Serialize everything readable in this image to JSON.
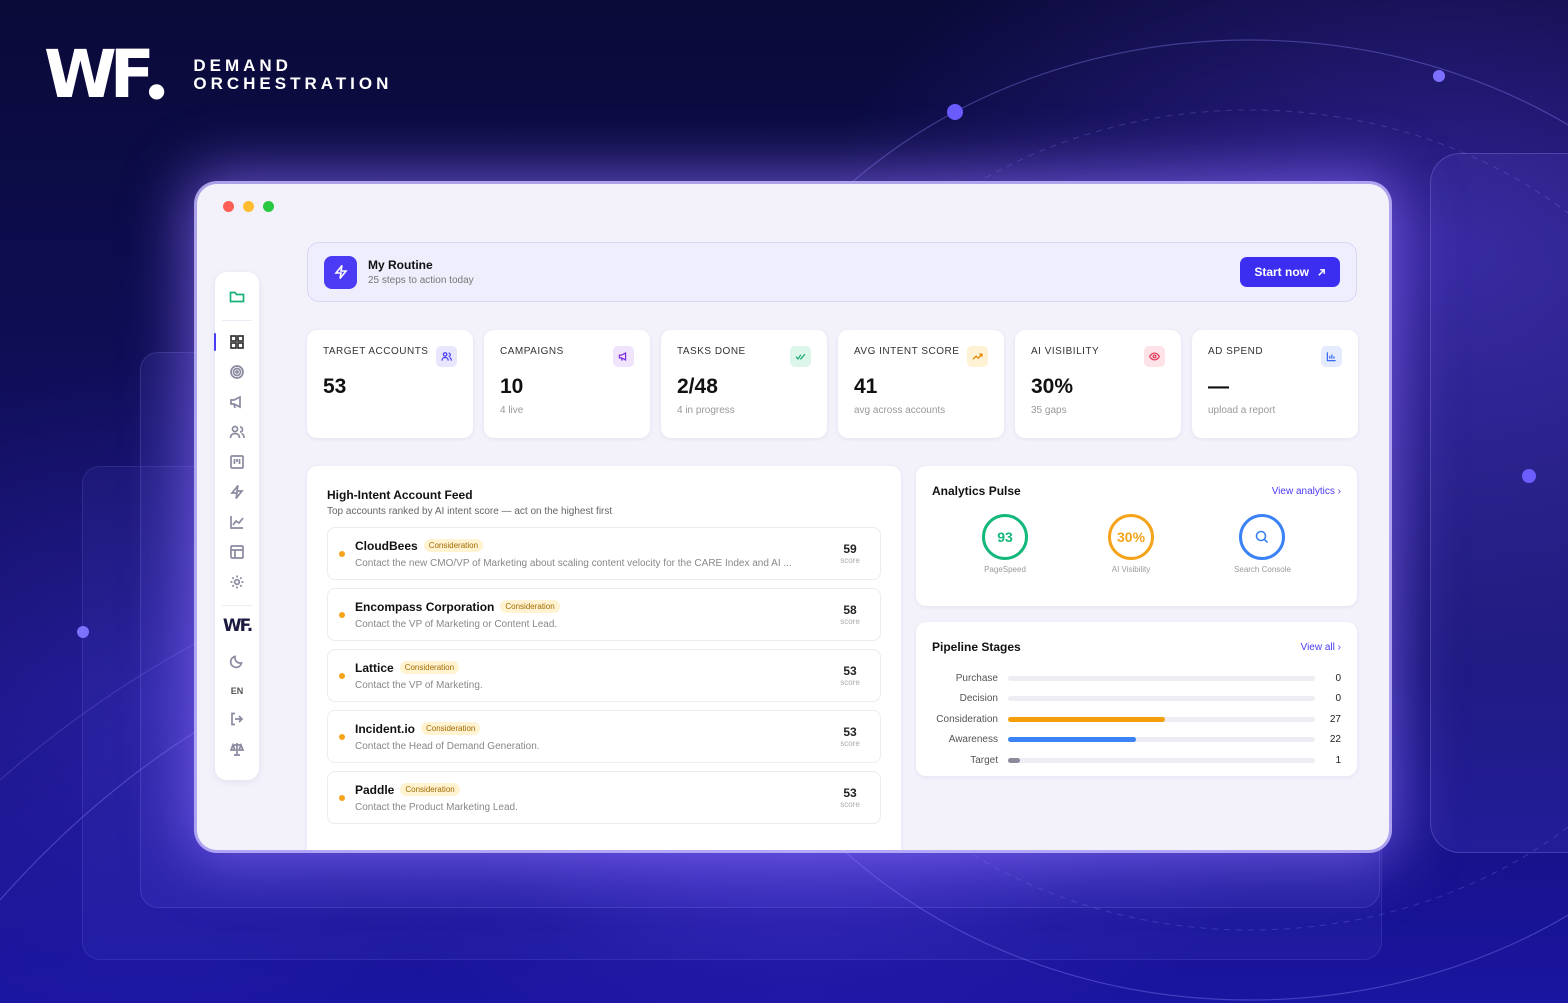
{
  "brand": {
    "line1": "DEMAND",
    "line2": "ORCHESTRATION"
  },
  "colors": {
    "accent": "#3b2ef0",
    "score_dot": "#f5a31a"
  },
  "sidebar": {
    "lang": "EN",
    "icons": [
      "folder-icon",
      "dashboard-icon",
      "target-icon",
      "megaphone-icon",
      "users-icon",
      "board-icon",
      "bolt-icon",
      "chart-line-icon",
      "layout-icon",
      "gear-icon",
      "wf-logo",
      "moon-icon",
      "logout-icon",
      "scale-icon"
    ]
  },
  "routine": {
    "title": "My Routine",
    "subtitle": "25 steps to action today",
    "button": "Start now"
  },
  "stats": [
    {
      "label": "TARGET ACCOUNTS",
      "value": "53",
      "sub": "",
      "icon": "users-icon",
      "color": "#4b3bf5",
      "bg": "#e8e6fd"
    },
    {
      "label": "CAMPAIGNS",
      "value": "10",
      "sub": "4 live",
      "icon": "megaphone-icon",
      "color": "#7b2ee0",
      "bg": "#efe4fb"
    },
    {
      "label": "TASKS DONE",
      "value": "2/48",
      "sub": "4 in progress",
      "icon": "check-icon",
      "color": "#15a86a",
      "bg": "#ddf6ea"
    },
    {
      "label": "AVG INTENT SCORE",
      "value": "41",
      "sub": "avg across accounts",
      "icon": "trend-icon",
      "color": "#e08a00",
      "bg": "#fff1d4"
    },
    {
      "label": "AI VISIBILITY",
      "value": "30%",
      "sub": "35 gaps",
      "icon": "eye-icon",
      "color": "#e23a5a",
      "bg": "#fde3e8"
    },
    {
      "label": "AD SPEND",
      "value": "—",
      "sub": "upload a report",
      "icon": "bar-chart-icon",
      "color": "#3b6bf0",
      "bg": "#e3ebfd"
    }
  ],
  "feed": {
    "title": "High-Intent Account Feed",
    "subtitle": "Top accounts ranked by AI intent score — act on the highest first",
    "items": [
      {
        "name": "CloudBees",
        "stage": "Consideration",
        "desc": "Contact the new CMO/VP of Marketing about scaling content velocity for the CARE Index and AI ...",
        "score": "59",
        "score_label": "score"
      },
      {
        "name": "Encompass Corporation",
        "stage": "Consideration",
        "desc": "Contact the VP of Marketing or Content Lead.",
        "score": "58",
        "score_label": "score"
      },
      {
        "name": "Lattice",
        "stage": "Consideration",
        "desc": "Contact the VP of Marketing.",
        "score": "53",
        "score_label": "score"
      },
      {
        "name": "Incident.io",
        "stage": "Consideration",
        "desc": "Contact the Head of Demand Generation.",
        "score": "53",
        "score_label": "score"
      },
      {
        "name": "Paddle",
        "stage": "Consideration",
        "desc": "Contact the Product Marketing Lead.",
        "score": "53",
        "score_label": "score"
      }
    ]
  },
  "pulse": {
    "title": "Analytics Pulse",
    "link": "View analytics",
    "gauges": [
      {
        "value": "93",
        "label": "PageSpeed",
        "color": "#14b87a"
      },
      {
        "value": "30%",
        "label": "AI Visibility",
        "color": "#f5a31a"
      },
      {
        "value": "",
        "label": "Search Console",
        "color": "#3b82f6"
      }
    ]
  },
  "pipeline": {
    "title": "Pipeline Stages",
    "link": "View all",
    "max": 27,
    "rows": [
      {
        "label": "Purchase",
        "value": 0,
        "color": "#cfcfe0"
      },
      {
        "label": "Decision",
        "value": 0,
        "color": "#cfcfe0"
      },
      {
        "label": "Consideration",
        "value": 27,
        "color": "#f59e0b"
      },
      {
        "label": "Awareness",
        "value": 22,
        "color": "#3b82f6"
      },
      {
        "label": "Target",
        "value": 1,
        "color": "#8a8a9a"
      }
    ]
  }
}
